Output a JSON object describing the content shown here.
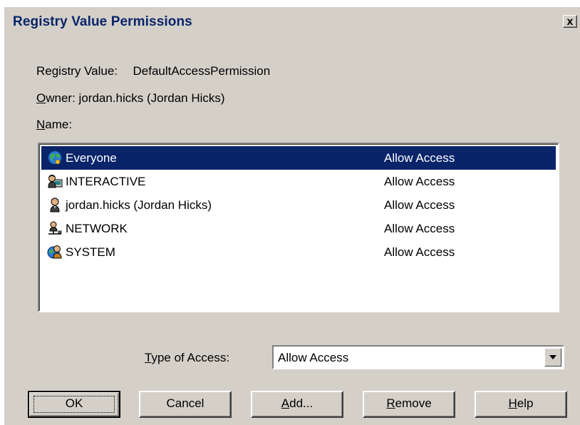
{
  "window": {
    "title": "Registry Value Permissions",
    "close_label": "x"
  },
  "info": {
    "registry_value_label": "Registry Value:",
    "registry_value": "DefaultAccessPermission",
    "owner_label": "wner:",
    "owner_mnemonic": "O",
    "owner_value": "jordan.hicks (Jordan Hicks)",
    "name_label": "ame:",
    "name_mnemonic": "N"
  },
  "permissions": [
    {
      "name": "Everyone",
      "access": "Allow Access",
      "icon": "globe-icon",
      "selected": true
    },
    {
      "name": "INTERACTIVE",
      "access": "Allow Access",
      "icon": "interactive-user-icon",
      "selected": false
    },
    {
      "name": "jordan.hicks (Jordan Hicks)",
      "access": "Allow Access",
      "icon": "user-icon",
      "selected": false
    },
    {
      "name": "NETWORK",
      "access": "Allow Access",
      "icon": "network-user-icon",
      "selected": false
    },
    {
      "name": "SYSTEM",
      "access": "Allow Access",
      "icon": "system-icon",
      "selected": false
    }
  ],
  "access_type": {
    "label_mnemonic": "T",
    "label_rest": "ype of Access:",
    "selected": "Allow Access"
  },
  "buttons": {
    "ok": "OK",
    "cancel": "Cancel",
    "add_mnemonic": "A",
    "add_rest": "dd...",
    "remove_mnemonic": "R",
    "remove_rest": "emove",
    "help_mnemonic": "H",
    "help_rest": "elp"
  },
  "colors": {
    "dialog_bg": "#d4d0c8",
    "title_text": "#0a246a",
    "selection_bg": "#0a246a",
    "selection_text": "#ffffff"
  }
}
